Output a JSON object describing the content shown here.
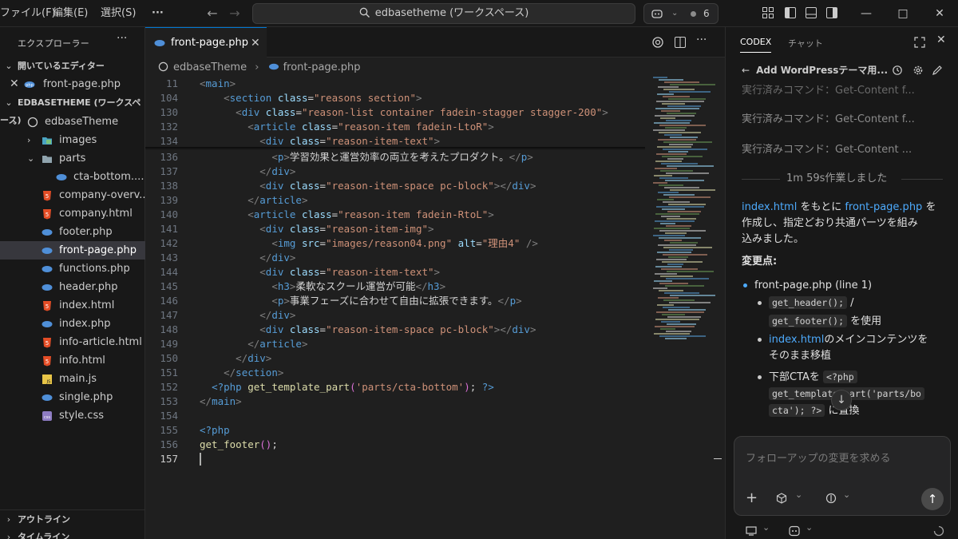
{
  "menu": {
    "file": "ファイル(F)",
    "edit": "編集(E)",
    "select": "選択(S)",
    "more": "···"
  },
  "search": {
    "text": "edbasetheme (ワークスペース)"
  },
  "copilot": {
    "count": "6"
  },
  "sidebar": {
    "title": "エクスプローラー",
    "open_editors": "開いているエディター",
    "open_file": "front-page.php",
    "workspace": "EDBASETHEME (ワークスペース)",
    "root": "edbaseTheme",
    "items": [
      {
        "label": "images",
        "kind": "folder-img"
      },
      {
        "label": "parts",
        "kind": "folder"
      },
      {
        "label": "cta-bottom....",
        "kind": "php"
      },
      {
        "label": "company-overv...",
        "kind": "html"
      },
      {
        "label": "company.html",
        "kind": "html"
      },
      {
        "label": "footer.php",
        "kind": "php"
      },
      {
        "label": "front-page.php",
        "kind": "php"
      },
      {
        "label": "functions.php",
        "kind": "php"
      },
      {
        "label": "header.php",
        "kind": "php"
      },
      {
        "label": "index.html",
        "kind": "html"
      },
      {
        "label": "index.php",
        "kind": "php"
      },
      {
        "label": "info-article.html",
        "kind": "html"
      },
      {
        "label": "info.html",
        "kind": "html"
      },
      {
        "label": "main.js",
        "kind": "js"
      },
      {
        "label": "single.php",
        "kind": "php"
      },
      {
        "label": "style.css",
        "kind": "css"
      }
    ],
    "outline": "アウトライン",
    "timeline": "タイムライン"
  },
  "editor": {
    "tab": "front-page.php",
    "breadcrumb": {
      "root": "edbaseTheme",
      "file": "front-page.php"
    },
    "line_numbers": [
      "11",
      "104",
      "130",
      "132",
      "134",
      "136",
      "137",
      "138",
      "139",
      "140",
      "141",
      "142",
      "143",
      "144",
      "145",
      "146",
      "147",
      "148",
      "149",
      "150",
      "151",
      "152",
      "153",
      "154",
      "155",
      "156",
      "157"
    ],
    "code": {
      "l11": "<main>",
      "l104": "<section class=\"reasons section\">",
      "l130": "<div class=\"reason-list container fadein-stagger stagger-200\">",
      "l132": "<article class=\"reason-item fadein-LtoR\">",
      "l134": "<div class=\"reason-item-text\">",
      "l136_text": "学習効果と運営効率の両立を考えたプロダクト。",
      "l145_text": "柔軟なスクール運営が可能",
      "l146_text": "事業フェーズに合わせて自由に拡張できます。",
      "img_src": "images/reason04.png",
      "img_alt": "理由4",
      "template_part": "parts/cta-bottom",
      "footer_fn": "get_footer"
    }
  },
  "panel": {
    "tab_codex": "CODEX",
    "tab_chat": "チャット",
    "thread_title": "Add WordPressテーマ用...",
    "commands": [
      "実行済みコマンド：Get-Content f...",
      "実行済みコマンド：Get-Content f...",
      "実行済みコマンド：Get-Content ..."
    ],
    "worked": "1m 59s作業しました",
    "summary_link1": "index.html",
    "summary_mid": "をもとに",
    "summary_link2": "front-page.php",
    "summary_rest1": "を",
    "summary_line2": "作成し、指定どおり共通パーツを組み",
    "summary_line3": "込みました。",
    "changes_heading": "変更点:",
    "bullet1_link": "front-page.php (line 1)",
    "chip_header": "get_header();",
    "slash": "/",
    "chip_footer": "get_footer();",
    "use_text": "を使用",
    "b3_link": "index.html",
    "b3_text1": "のメインコンテンツを",
    "b3_text2": "そのまま移植",
    "b4_text": "下部CTAを",
    "b4_chip1": "<?php",
    "b4_chip2": "get_template_part('parts/bo",
    "b4_chip3": "cta'); ?>",
    "b4_end": "に置換",
    "input_placeholder": "フォローアップの変更を求める"
  }
}
